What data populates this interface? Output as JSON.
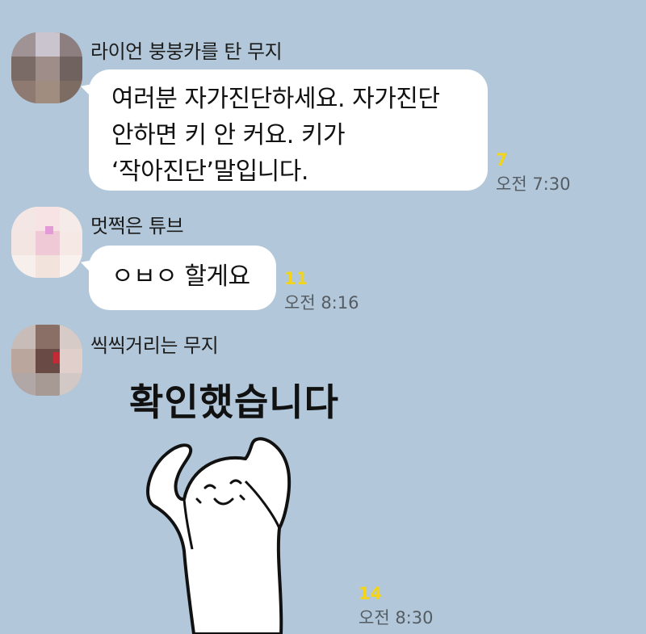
{
  "chat": {
    "messages": [
      {
        "sender": "라이언 붕붕카를 탄 무지",
        "lines": [
          "여러분 자가진단하세요. 자가진단",
          "안하면 키 안 커요. 키가",
          "‘작아진단’말입니다."
        ],
        "unread": "7",
        "time": "오전 7:30"
      },
      {
        "sender": "멋쩍은 튜브",
        "lines": [
          "ㅇㅂㅇ 할게요"
        ],
        "unread": "11",
        "time": "오전 8:16"
      },
      {
        "sender": "씩씩거리는 무지",
        "sticker_text": "확인했습니다",
        "sticker_icon": "cheering-character-icon",
        "unread": "14",
        "time": "오전 8:30"
      }
    ]
  },
  "colors": {
    "background": "#b2c7d9",
    "bubble": "#ffffff",
    "unread": "#f2d51a",
    "time": "#555c63"
  }
}
